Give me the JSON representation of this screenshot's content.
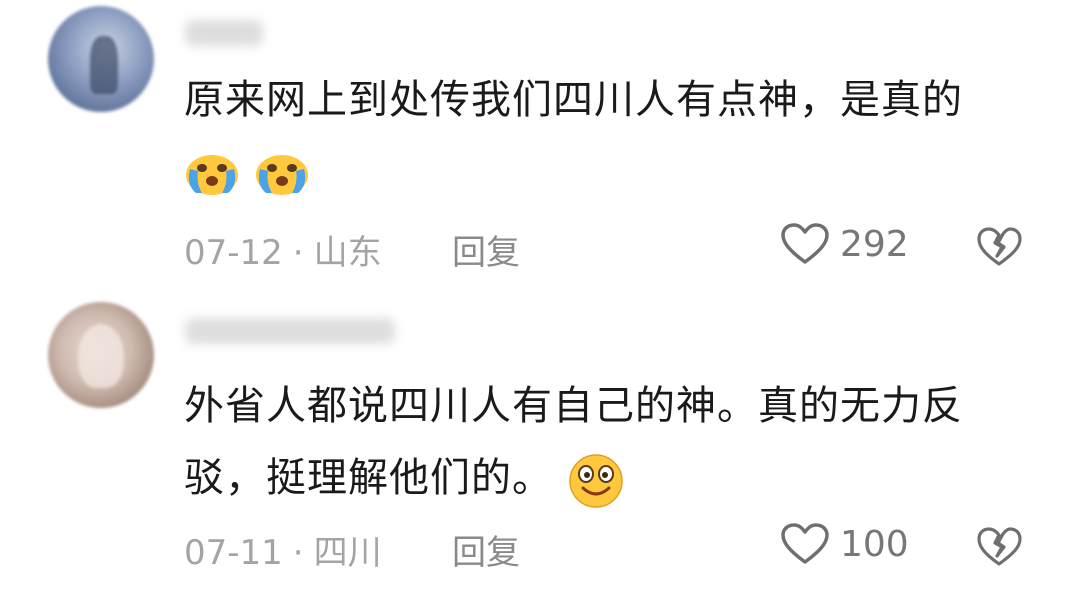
{
  "comments": [
    {
      "text_line1": "原来网上到处传我们四川人有点神，是真的",
      "emojis": [
        "crying-face-emoji",
        "crying-face-emoji"
      ],
      "date": "07-12",
      "separator": "·",
      "location": "山东",
      "reply_label": "回复",
      "likes": "292"
    },
    {
      "text_line1": "外省人都说四川人有自己的神。真的无力反",
      "text_line2": "驳，挺理解他们的。",
      "emojis": [
        "smiling-face-emoji"
      ],
      "date": "07-11",
      "separator": "·",
      "location": "四川",
      "reply_label": "回复",
      "likes": "100"
    }
  ],
  "colors": {
    "meta_text": "#a4a4a4",
    "body_text": "#1a1a1a",
    "emoji_yellow": "#ffc83d",
    "tear_blue": "#4aa3e8"
  }
}
